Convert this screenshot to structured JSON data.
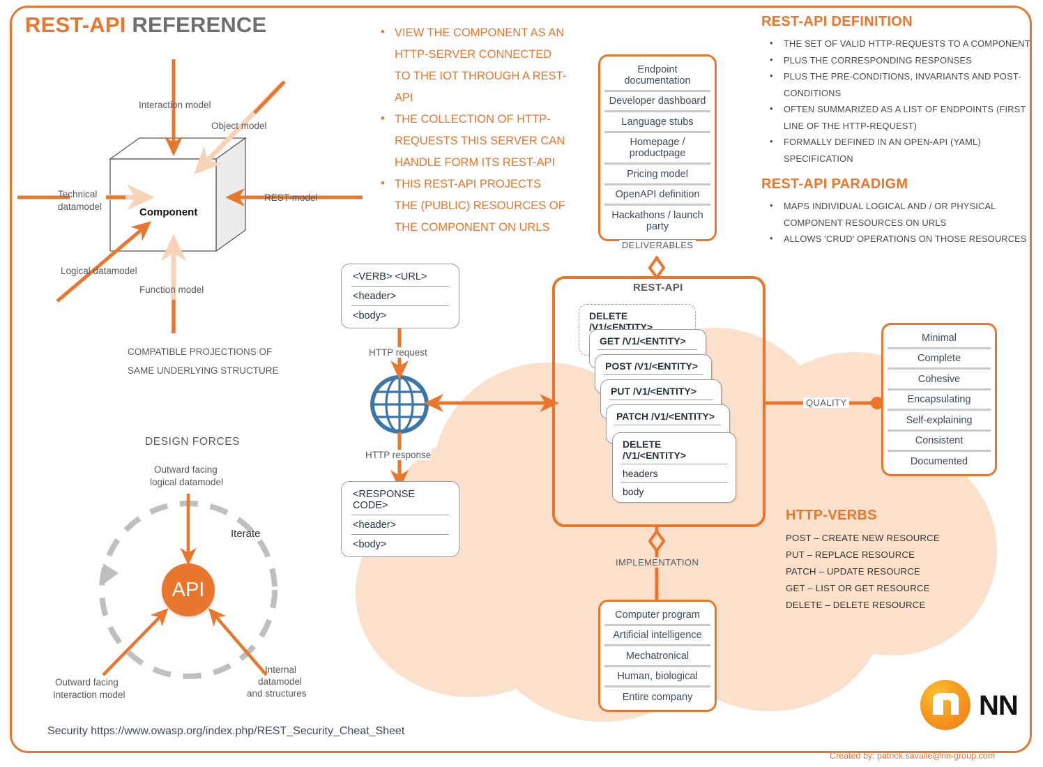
{
  "title": {
    "accent": "REST-API",
    "rest": " REFERENCE"
  },
  "cube": {
    "center_label": "Component",
    "top_label": "Interaction model",
    "top_right_label": "Object model",
    "left_label_line1": "Technical",
    "left_label_line2": "datamodel",
    "right_label": "REST-model",
    "bottom_left_label": "Logical datamodel",
    "bottom_label": "Function model",
    "caption_line1": "COMPATIBLE PROJECTIONS OF",
    "caption_line2": "SAME UNDERLYING STRUCTURE"
  },
  "intro_bullets": [
    "VIEW THE COMPONENT AS AN HTTP-SERVER CONNECTED TO THE IOT THROUGH A REST-API",
    "THE COLLECTION OF HTTP-REQUESTS THIS SERVER CAN HANDLE FORM ITS REST-API",
    "THIS REST-API PROJECTS THE (PUBLIC) RESOURCES OF THE COMPONENT ON URLS"
  ],
  "definition": {
    "heading": "REST-API DEFINITION",
    "bullets": [
      "THE SET OF VALID HTTP-REQUESTS TO A COMPONENT",
      "PLUS THE CORRESPONDING RESPONSES",
      "PLUS THE PRE-CONDITIONS, INVARIANTS AND POST-CONDITIONS",
      "OFTEN SUMMARIZED AS A LIST OF ENDPOINTS (FIRST LINE OF THE HTTP-REQUEST)",
      "FORMALLY DEFINED IN AN OPEN-API (YAML) SPECIFICATION"
    ]
  },
  "paradigm": {
    "heading": "REST-API PARADIGM",
    "bullets": [
      "MAPS INDIVIDUAL LOGICAL AND / OR PHYSICAL COMPONENT RESOURCES ON URLS",
      "ALLOWS 'CRUD' OPERATIONS ON THOSE RESOURCES"
    ]
  },
  "deliverables": {
    "items": [
      "Endpoint documentation",
      "Developer dashboard",
      "Language stubs",
      "Homepage / productpage",
      "Pricing model",
      "OpenAPI definition",
      "Hackathons / launch party"
    ],
    "relation_label": "DELIVERABLES"
  },
  "restapi_box": {
    "title": "REST-API",
    "cards": [
      {
        "lines": [
          "DELETE /V1/<ENTITY>"
        ],
        "dashed": true
      },
      {
        "lines": [
          "GET /V1/<ENTITY>",
          ""
        ],
        "dashed": false
      },
      {
        "lines": [
          "POST /V1/<ENTITY>",
          ""
        ],
        "dashed": false
      },
      {
        "lines": [
          "PUT /V1/<ENTITY>",
          ""
        ],
        "dashed": false
      },
      {
        "lines": [
          "PATCH /V1/<ENTITY>",
          ""
        ],
        "dashed": false
      },
      {
        "lines": [
          "DELETE /V1/<ENTITY>",
          "headers",
          "body"
        ],
        "dashed": false
      }
    ]
  },
  "http_request_card": {
    "rows": [
      "<VERB>  <URL>",
      "<header>",
      "<body>"
    ]
  },
  "http_response_card": {
    "rows": [
      "<RESPONSE CODE>",
      "<header>",
      "<body>"
    ]
  },
  "http_request_label": "HTTP request",
  "http_response_label": "HTTP response",
  "quality": {
    "relation_label": "QUALITY",
    "items": [
      "Minimal",
      "Complete",
      "Cohesive",
      "Encapsulating",
      "Self-explaining",
      "Consistent",
      "Documented"
    ]
  },
  "implementation": {
    "relation_label": "IMPLEMENTATION",
    "items": [
      "Computer program",
      "Artificial intelligence",
      "Mechatronical",
      "Human, biological",
      "Entire company"
    ]
  },
  "http_verbs": {
    "heading": "HTTP-VERBS",
    "lines": [
      "POST – CREATE NEW RESOURCE",
      "PUT – REPLACE  RESOURCE",
      "PATCH – UPDATE RESOURCE",
      "GET – LIST OR GET RESOURCE",
      "DELETE – DELETE RESOURCE"
    ]
  },
  "design_forces": {
    "heading": "DESIGN FORCES",
    "center": "API",
    "iterate": "Iterate",
    "top_label_line1": "Outward facing",
    "top_label_line2": "logical datamodel",
    "left_label_line1": "Outward facing",
    "left_label_line2": "Interaction model",
    "right_label_line1": "Internal",
    "right_label_line2": "datamodel",
    "right_label_line3": "and structures"
  },
  "footer": {
    "security": "Security https://www.owasp.org/index.php/REST_Security_Cheat_Sheet",
    "credit": "Created by: patrick.savalle@nn-group.com",
    "logo_text": "NN"
  },
  "colors": {
    "accent": "#E8762C",
    "cloud": "#FBE0CC",
    "grey_text": "#5A5A5A",
    "globe": "#3C76A8"
  }
}
